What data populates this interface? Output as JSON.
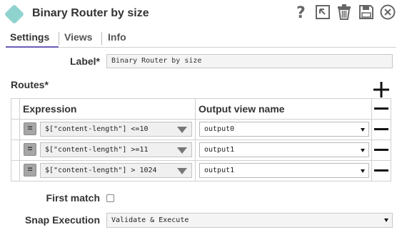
{
  "header": {
    "title": "Binary Router by size",
    "icons": [
      "help-icon",
      "export-icon",
      "trash-icon",
      "save-icon",
      "close-icon"
    ]
  },
  "tabs": [
    {
      "label": "Settings",
      "active": true
    },
    {
      "label": "Views",
      "active": false
    },
    {
      "label": "Info",
      "active": false
    }
  ],
  "form": {
    "label_label": "Label*",
    "label_value": "Binary Router by size",
    "routes_label": "Routes*",
    "first_match_label": "First match",
    "first_match_checked": false,
    "snap_execution_label": "Snap Execution",
    "snap_execution_value": "Validate & Execute"
  },
  "routes": {
    "columns": [
      "Expression",
      "Output view name"
    ],
    "rows": [
      {
        "expression": "$[\"content-length\"] <=10",
        "output": "output0"
      },
      {
        "expression": "$[\"content-length\"] >=11",
        "output": "output1"
      },
      {
        "expression": "$[\"content-length\"] > 1024",
        "output": "output1"
      }
    ],
    "row_button": "="
  },
  "colors": {
    "accent": "#6b5bb0",
    "snap_icon": "#8fd3cf"
  }
}
